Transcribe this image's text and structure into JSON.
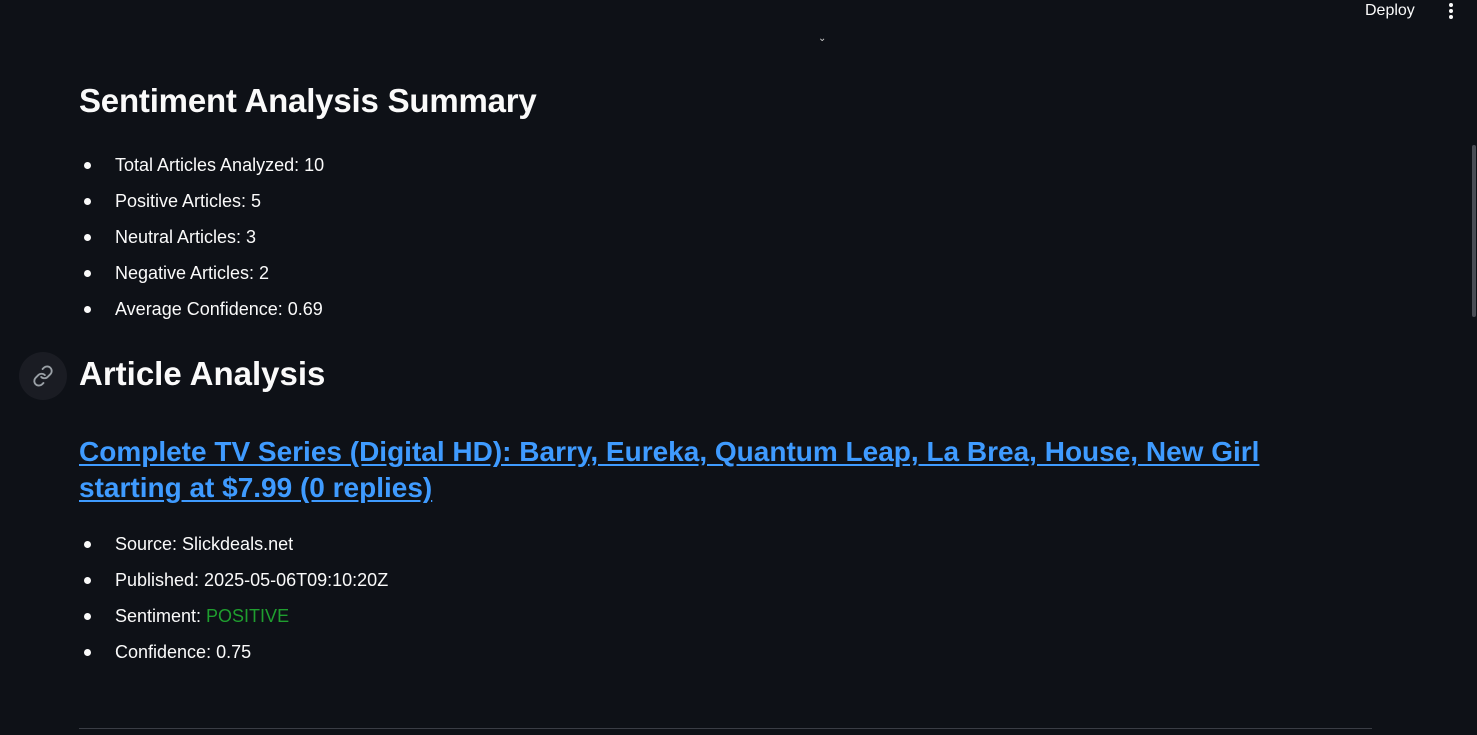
{
  "toolbar": {
    "deploy_label": "Deploy",
    "menu_icon": "more-vertical-icon",
    "expand_icon_glyph": "⌄"
  },
  "summary": {
    "title": "Sentiment Analysis Summary",
    "items": [
      "Total Articles Analyzed: 10",
      "Positive Articles: 5",
      "Neutral Articles: 3",
      "Negative Articles: 2",
      "Average Confidence: 0.69"
    ]
  },
  "article_analysis": {
    "heading": "Article Analysis",
    "anchor_icon": "link-icon",
    "article": {
      "title": "Complete TV Series (Digital HD): Barry, Eureka, Quantum Leap, La Brea, House, New Girl starting at $7.99 (0 replies)",
      "source": "Source: Slickdeals.net",
      "published": "Published: 2025-05-06T09:10:20Z",
      "sentiment_label": "Sentiment: ",
      "sentiment_value": "POSITIVE",
      "confidence": "Confidence: 0.75"
    }
  },
  "colors": {
    "background": "#0e1117",
    "text": "#fafafa",
    "link": "#3f9bff",
    "positive": "#1f9e2f"
  }
}
